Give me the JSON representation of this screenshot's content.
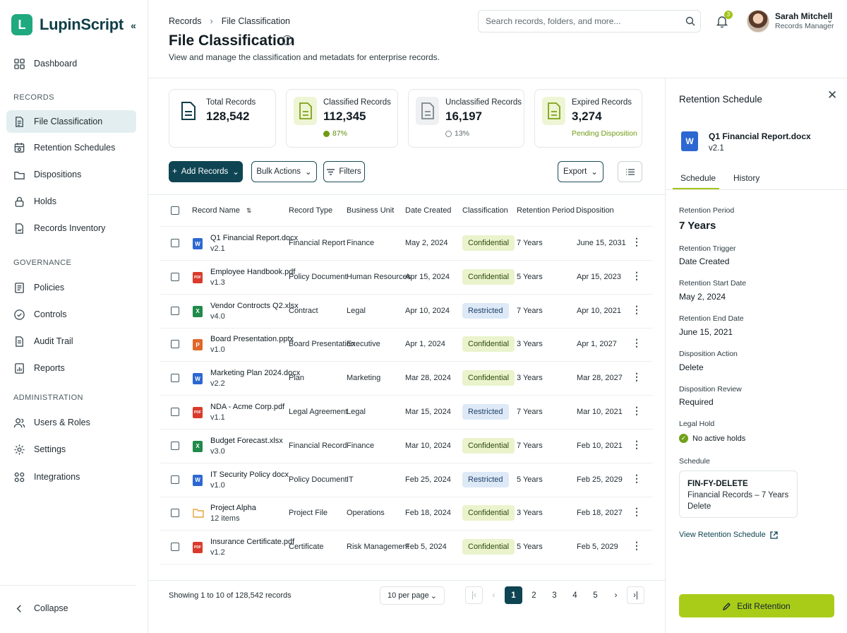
{
  "app": {
    "name": "LupinScript"
  },
  "sidebar": {
    "main": [
      {
        "label": "Dashboard"
      }
    ],
    "records_section": "RECORDS",
    "records": [
      {
        "label": "File Classification"
      },
      {
        "label": "Retention Schedules"
      },
      {
        "label": "Dispositions"
      },
      {
        "label": "Holds"
      },
      {
        "label": "Records Inventory"
      }
    ],
    "governance_section": "GOVERNANCE",
    "governance": [
      {
        "label": "Policies"
      },
      {
        "label": "Controls"
      },
      {
        "label": "Audit Trail"
      },
      {
        "label": "Reports"
      }
    ],
    "admin_section": "ADMINISTRATION",
    "admin": [
      {
        "label": "Users & Roles"
      },
      {
        "label": "Settings"
      },
      {
        "label": "Integrations"
      }
    ],
    "collapse": "Collapse"
  },
  "header": {
    "breadcrumb": [
      "Records",
      "File Classification"
    ],
    "title": "File Classification",
    "subtitle": "View and manage the classification and metadats for enterprise records.",
    "search_placeholder": "Search records, folders, and more...",
    "notif_count": "3",
    "user": {
      "name": "Sarah Mitchell",
      "role": "Records Manager"
    }
  },
  "stats": [
    {
      "label": "Total Records",
      "value": "128,542",
      "sub": ""
    },
    {
      "label": "Classified Records",
      "value": "112,345",
      "sub": "87%"
    },
    {
      "label": "Unclassified Records",
      "value": "16,197",
      "sub": "13%"
    },
    {
      "label": "Expired Records",
      "value": "3,274",
      "sub": "Pending Disposition"
    }
  ],
  "toolbar": {
    "add": "Add Records",
    "bulk": "Bulk Actions",
    "filters": "Filters",
    "export": "Export"
  },
  "table": {
    "columns": [
      "Record Name",
      "Record Type",
      "Business Unit",
      "Date Created",
      "Classification",
      "Retention Period",
      "Disposition"
    ],
    "rows": [
      {
        "name": "Q1 Financial Report.docx",
        "ver": "v2.1",
        "icon": "word-icon",
        "type": "Financial Report",
        "unit": "Finance",
        "created": "May 2, 2024",
        "class": "Confidential",
        "retention": "7 Years",
        "disposition": "June 15, 2031"
      },
      {
        "name": "Employee Handbook.pdf",
        "ver": "v1.3",
        "icon": "pdf-icon",
        "type": "Policy Document",
        "unit": "Human Resources",
        "created": "Apr 15, 2024",
        "class": "Confidential",
        "retention": "5 Years",
        "disposition": "Apr 15, 2023"
      },
      {
        "name": "Vendor Controcts Q2.xlsx",
        "ver": "v4.0",
        "icon": "excel-icon",
        "type": "Contract",
        "unit": "Legal",
        "created": "Apr 10, 2024",
        "class": "Restricted",
        "retention": "7 Years",
        "disposition": "Apr 10, 2021"
      },
      {
        "name": "Board Presentation.pptx",
        "ver": "v1.0",
        "icon": "powerpoint-icon",
        "type": "Board Presentation",
        "unit": "Executive",
        "created": "Apr 1, 2024",
        "class": "Confidential",
        "retention": "3 Years",
        "disposition": "Apr 1, 2027"
      },
      {
        "name": "Marketing Plan 2024.docx",
        "ver": "v2.2",
        "icon": "word-icon",
        "type": "Plan",
        "unit": "Marketing",
        "created": "Mar 28, 2024",
        "class": "Confidential",
        "retention": "3 Years",
        "disposition": "Mar 28, 2027"
      },
      {
        "name": "NDA - Acme Corp.pdf",
        "ver": "v1.1",
        "icon": "pdf-icon",
        "type": "Legal Agreement",
        "unit": "Legal",
        "created": "Mar 15, 2024",
        "class": "Restricted",
        "retention": "7 Years",
        "disposition": "Mar 10, 2021"
      },
      {
        "name": "Budget Forecast.xlsx",
        "ver": "v3.0",
        "icon": "excel-icon",
        "type": "Financial Record",
        "unit": "Finance",
        "created": "Mar 10, 2024",
        "class": "Confidential",
        "retention": "7 Years",
        "disposition": "Feb 10, 2021"
      },
      {
        "name": "IT Security Policy docx",
        "ver": "v1.0",
        "icon": "word-icon",
        "type": "Policy Document",
        "unit": "IT",
        "created": "Feb 25, 2024",
        "class": "Restricted",
        "retention": "5 Years",
        "disposition": "Feb 25, 2029"
      },
      {
        "name": "Project Alpha",
        "ver": "12 items",
        "icon": "folder-icon",
        "type": "Project File",
        "unit": "Operations",
        "created": "Feb 18, 2024",
        "class": "Confidential",
        "retention": "3 Years",
        "disposition": "Feb 18, 2027"
      },
      {
        "name": "Insurance Certificate.pdf",
        "ver": "v1.2",
        "icon": "pdf-icon",
        "type": "Certificate",
        "unit": "Risk Management",
        "created": "Feb 5, 2024",
        "class": "Confidential",
        "retention": "5 Years",
        "disposition": "Feb 5, 2029"
      }
    ]
  },
  "pagination": {
    "showing": "Showing 1 to 10 of 128,542 records",
    "per_page": "10 per page",
    "pages": [
      "1",
      "2",
      "3",
      "4",
      "5"
    ]
  },
  "panel": {
    "title": "Retention Schedule",
    "file": "Q1 Financial Report.docx",
    "version": "v2.1",
    "tabs": [
      "Schedule",
      "History"
    ],
    "fields": [
      {
        "label": "Retention Period",
        "value": "7 Years"
      },
      {
        "label": "Retention Trigger",
        "value": "Date Created"
      },
      {
        "label": "Retention Start Date",
        "value": "May 2, 2024"
      },
      {
        "label": "Retention End Date",
        "value": "June 15, 2021"
      },
      {
        "label": "Disposition Action",
        "value": "Delete"
      },
      {
        "label": "Disposition Review",
        "value": "Required"
      }
    ],
    "legal_hold_label": "Legal Hold",
    "legal_hold_value": "No active holds",
    "schedule_label": "Schedule",
    "schedule_code": "FIN-FY-DELETE",
    "schedule_desc": "Financial Records – 7 Years",
    "schedule_action": "Delete",
    "view_link": "View Retention Schedule",
    "edit_button": "Edit Retention"
  },
  "colors": {
    "primary": "#0f4553",
    "accent": "#a9cc19",
    "brand": "#1fa97f"
  }
}
